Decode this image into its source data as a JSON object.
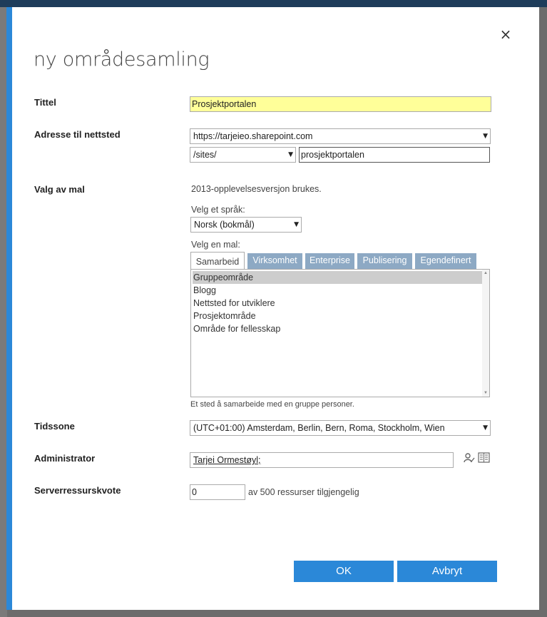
{
  "dialog": {
    "title": "ny områdesamling",
    "close_glyph": "×"
  },
  "form": {
    "title_label": "Tittel",
    "title_value": "Prosjektportalen",
    "address_label": "Adresse til nettsted",
    "address_domain": "https://tarjeieo.sharepoint.com",
    "address_path": "/sites/",
    "address_name": "prosjektportalen",
    "template_label": "Valg av mal",
    "experience_note": "2013-opplevelsesversjon brukes.",
    "language_label": "Velg et språk:",
    "language_value": "Norsk (bokmål)",
    "template_choose_label": "Velg en mal:",
    "tabs": [
      {
        "label": "Samarbeid",
        "active": true
      },
      {
        "label": "Virksomhet",
        "active": false
      },
      {
        "label": "Enterprise",
        "active": false
      },
      {
        "label": "Publisering",
        "active": false
      },
      {
        "label": "Egendefinert",
        "active": false
      }
    ],
    "templates": [
      {
        "label": "Gruppeområde",
        "selected": true
      },
      {
        "label": "Blogg",
        "selected": false
      },
      {
        "label": "Nettsted for utviklere",
        "selected": false
      },
      {
        "label": "Prosjektområde",
        "selected": false
      },
      {
        "label": "Område for fellesskap",
        "selected": false
      }
    ],
    "template_description": "Et sted å samarbeide med en gruppe personer.",
    "timezone_label": "Tidssone",
    "timezone_value": "(UTC+01:00) Amsterdam, Berlin, Bern, Roma, Stockholm, Wien",
    "admin_label": "Administrator",
    "admin_value": "Tarjei Ormestøyl;",
    "quota_label": "Serverressurskvote",
    "quota_value": "0",
    "quota_suffix": "av 500 ressurser tilgjengelig"
  },
  "buttons": {
    "ok": "OK",
    "cancel": "Avbryt"
  },
  "icons": {
    "close": "close-icon",
    "dropdown": "chevron-down-icon",
    "check_names": "check-names-icon",
    "browse": "address-book-icon"
  },
  "colors": {
    "accent": "#2b88d8",
    "title_field_bg": "#ffff99",
    "tab_inactive": "#8da9c4"
  }
}
